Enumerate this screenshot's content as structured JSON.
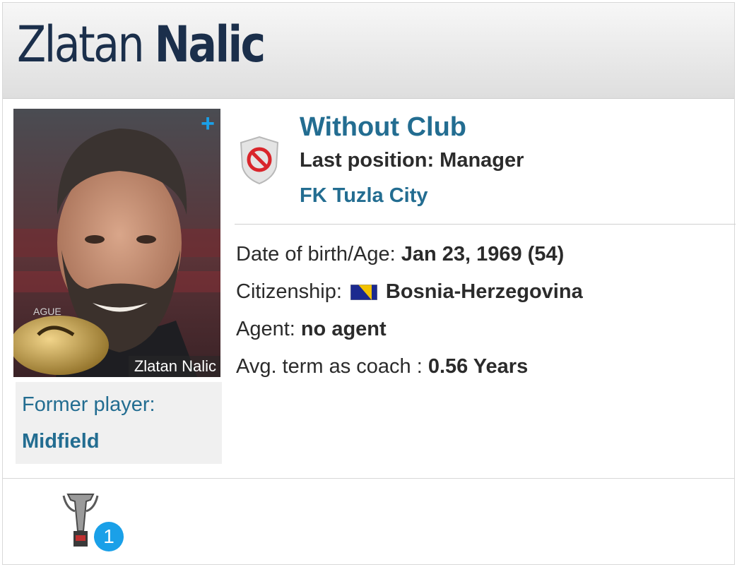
{
  "profile": {
    "first_name": "Zlatan",
    "last_name": "Nalic",
    "photo_caption": "Zlatan Nalic",
    "former_label": "Former player:",
    "former_position": "Midfield"
  },
  "club": {
    "status": "Without Club",
    "last_position": "Last position: Manager",
    "club_name": "FK Tuzla City",
    "badge_icon": "no-club-icon"
  },
  "info": {
    "dob_label": "Date of birth/Age:",
    "dob_value": "Jan 23, 1969 (54)",
    "citizenship_label": "Citizenship:",
    "citizenship_value": "Bosnia-Herzegovina",
    "agent_label": "Agent:",
    "agent_value": "no agent",
    "term_label": "Avg. term as coach :",
    "term_value": "0.56 Years"
  },
  "trophies": {
    "count": "1",
    "icon": "trophy-icon"
  },
  "colors": {
    "accent": "#236d91",
    "badge_blue": "#1aa0e8",
    "title": "#1b2f4b"
  }
}
